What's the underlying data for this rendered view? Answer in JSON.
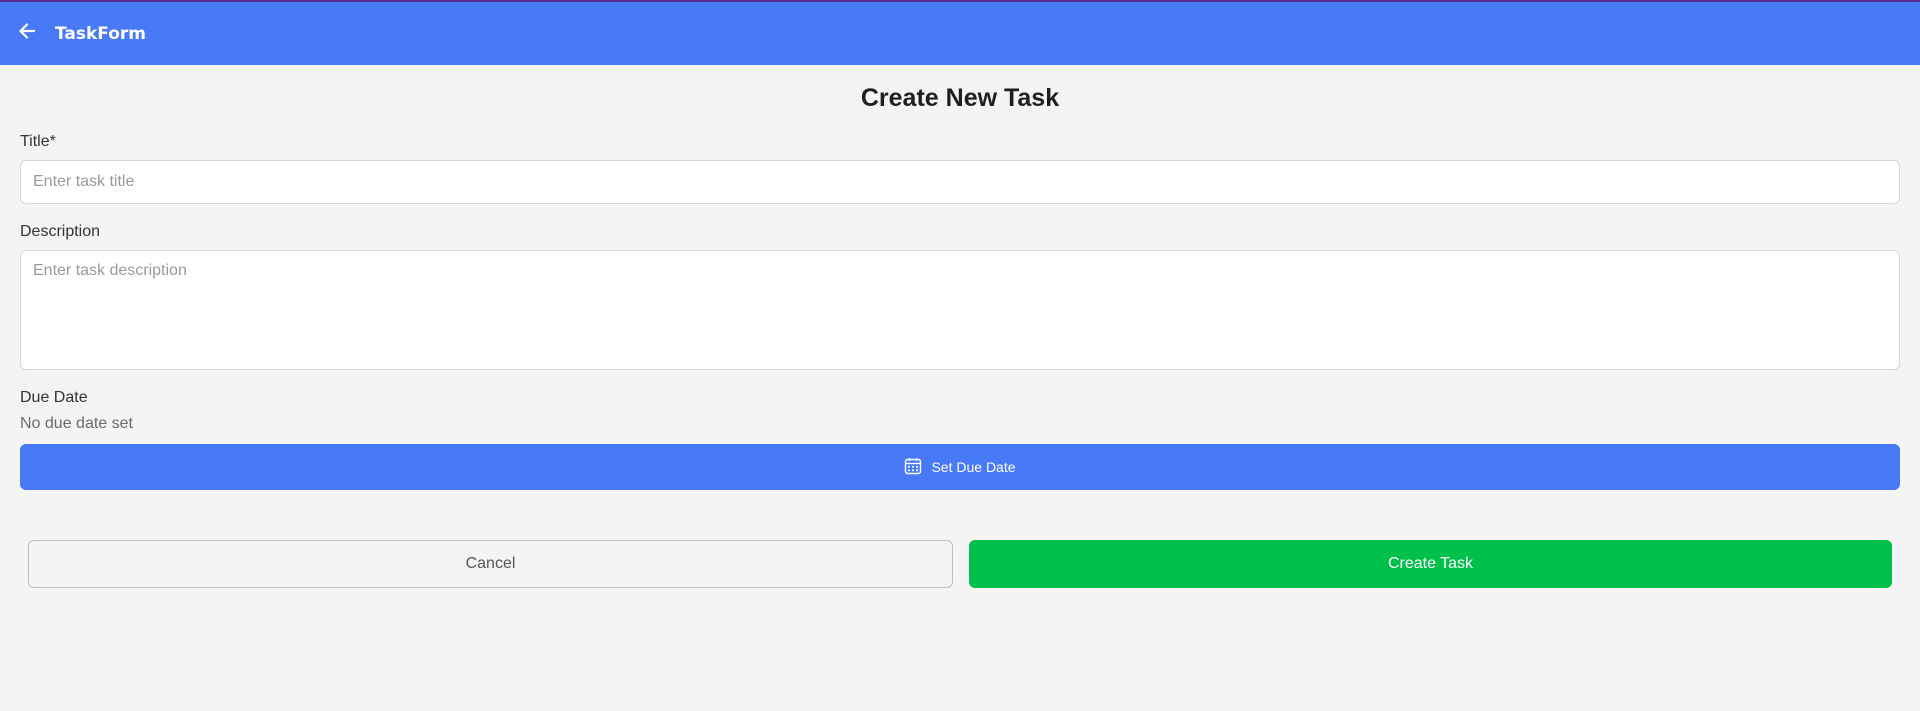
{
  "header": {
    "title": "TaskForm",
    "back_icon": "arrow-left-icon",
    "background_color": "#4879f7"
  },
  "page": {
    "title": "Create New Task"
  },
  "form": {
    "title_field": {
      "label": "Title*",
      "placeholder": "Enter task title",
      "value": ""
    },
    "description_field": {
      "label": "Description",
      "placeholder": "Enter task description",
      "value": ""
    },
    "due_date": {
      "label": "Due Date",
      "status": "No due date set",
      "button_label": "Set Due Date",
      "button_icon": "calendar-icon"
    }
  },
  "actions": {
    "cancel_label": "Cancel",
    "create_label": "Create Task",
    "create_color": "#00c04b"
  }
}
